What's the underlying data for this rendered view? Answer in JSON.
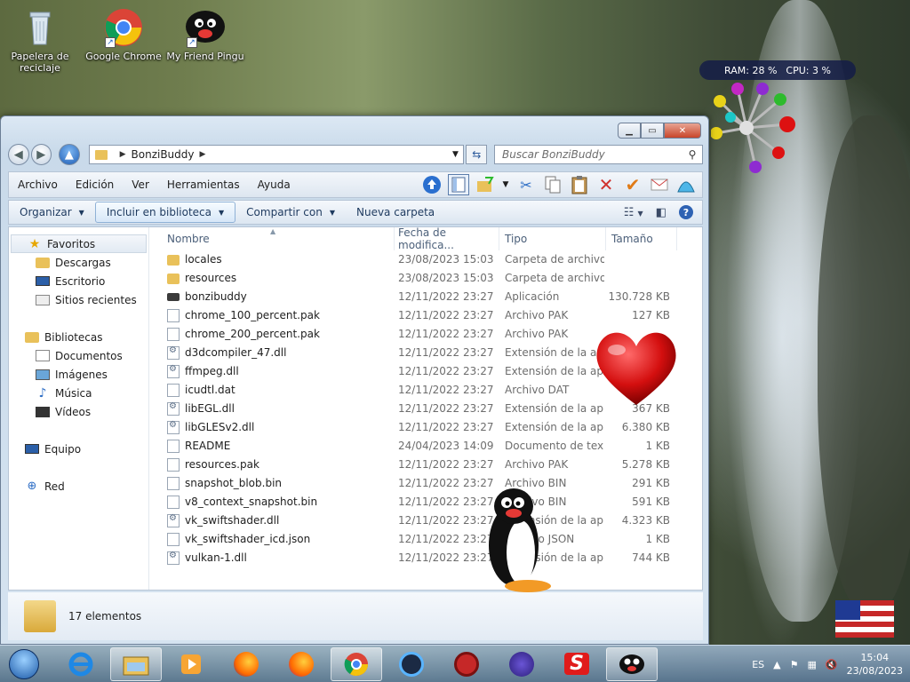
{
  "desktop": {
    "icons": [
      {
        "label": "Papelera de reciclaje"
      },
      {
        "label": "Google Chrome"
      },
      {
        "label": "My Friend Pingu"
      }
    ]
  },
  "gadget": {
    "ram": "RAM: 28 %",
    "cpu": "CPU: 3 %"
  },
  "window": {
    "address": {
      "crumb": "BonziBuddy"
    },
    "search": {
      "placeholder": "Buscar BonziBuddy"
    },
    "menu": [
      "Archivo",
      "Edición",
      "Ver",
      "Herramientas",
      "Ayuda"
    ],
    "commands": {
      "organize": "Organizar",
      "include": "Incluir en biblioteca",
      "share": "Compartir con",
      "new_folder": "Nueva carpeta"
    },
    "nav": {
      "favorites": "Favoritos",
      "downloads": "Descargas",
      "desktop": "Escritorio",
      "recent": "Sitios recientes",
      "libraries": "Bibliotecas",
      "documents": "Documentos",
      "images": "Imágenes",
      "music": "Música",
      "videos": "Vídeos",
      "computer": "Equipo",
      "network": "Red"
    },
    "columns": {
      "name": "Nombre",
      "date": "Fecha de modifica...",
      "type": "Tipo",
      "size": "Tamaño"
    },
    "files": [
      {
        "name": "locales",
        "date": "23/08/2023 15:03",
        "type": "Carpeta de archivos",
        "size": "",
        "icon": "folder"
      },
      {
        "name": "resources",
        "date": "23/08/2023 15:03",
        "type": "Carpeta de archivos",
        "size": "",
        "icon": "folder"
      },
      {
        "name": "bonzibuddy",
        "date": "12/11/2022 23:27",
        "type": "Aplicación",
        "size": "130.728 KB",
        "icon": "exe"
      },
      {
        "name": "chrome_100_percent.pak",
        "date": "12/11/2022 23:27",
        "type": "Archivo PAK",
        "size": "127 KB",
        "icon": "file"
      },
      {
        "name": "chrome_200_percent.pak",
        "date": "12/11/2022 23:27",
        "type": "Archivo PAK",
        "size": "",
        "icon": "file"
      },
      {
        "name": "d3dcompiler_47.dll",
        "date": "12/11/2022 23:27",
        "type": "Extensión de la apl...",
        "size": "",
        "icon": "dll"
      },
      {
        "name": "ffmpeg.dll",
        "date": "12/11/2022 23:27",
        "type": "Extensión de la apl...",
        "size": "",
        "icon": "dll"
      },
      {
        "name": "icudtl.dat",
        "date": "12/11/2022 23:27",
        "type": "Archivo DAT",
        "size": "",
        "icon": "file"
      },
      {
        "name": "libEGL.dll",
        "date": "12/11/2022 23:27",
        "type": "Extensión de la apl...",
        "size": "367 KB",
        "icon": "dll"
      },
      {
        "name": "libGLESv2.dll",
        "date": "12/11/2022 23:27",
        "type": "Extensión de la apl...",
        "size": "6.380 KB",
        "icon": "dll"
      },
      {
        "name": "README",
        "date": "24/04/2023 14:09",
        "type": "Documento de tex...",
        "size": "1 KB",
        "icon": "file"
      },
      {
        "name": "resources.pak",
        "date": "12/11/2022 23:27",
        "type": "Archivo PAK",
        "size": "5.278 KB",
        "icon": "file"
      },
      {
        "name": "snapshot_blob.bin",
        "date": "12/11/2022 23:27",
        "type": "Archivo BIN",
        "size": "291 KB",
        "icon": "file"
      },
      {
        "name": "v8_context_snapshot.bin",
        "date": "12/11/2022 23:27",
        "type": "Archivo BIN",
        "size": "591 KB",
        "icon": "file"
      },
      {
        "name": "vk_swiftshader.dll",
        "date": "12/11/2022 23:27",
        "type": "Extensión de la apl...",
        "size": "4.323 KB",
        "icon": "dll"
      },
      {
        "name": "vk_swiftshader_icd.json",
        "date": "12/11/2022 23:27",
        "type": "Archivo JSON",
        "size": "1 KB",
        "icon": "file"
      },
      {
        "name": "vulkan-1.dll",
        "date": "12/11/2022 23:27",
        "type": "Extensión de la apl...",
        "size": "744 KB",
        "icon": "dll"
      }
    ],
    "status": "17 elementos"
  },
  "taskbar": {
    "lang": "ES",
    "time": "15:04",
    "date": "23/08/2023"
  }
}
